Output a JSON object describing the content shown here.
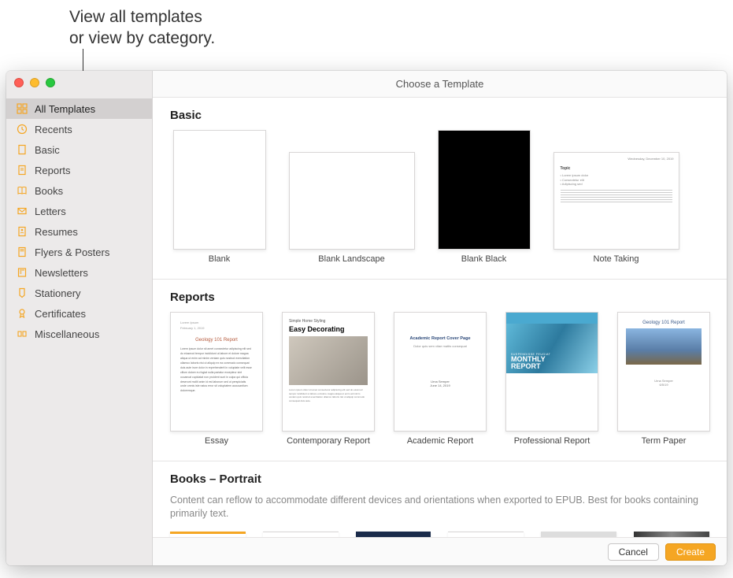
{
  "annotation": "View all templates\nor view by category.",
  "window_title": "Choose a Template",
  "sidebar": {
    "items": [
      {
        "label": "All Templates",
        "icon": "grid-icon",
        "selected": true
      },
      {
        "label": "Recents",
        "icon": "clock-icon"
      },
      {
        "label": "Basic",
        "icon": "page-icon"
      },
      {
        "label": "Reports",
        "icon": "report-icon"
      },
      {
        "label": "Books",
        "icon": "book-icon"
      },
      {
        "label": "Letters",
        "icon": "letter-icon"
      },
      {
        "label": "Resumes",
        "icon": "resume-icon"
      },
      {
        "label": "Flyers & Posters",
        "icon": "flyer-icon"
      },
      {
        "label": "Newsletters",
        "icon": "newsletter-icon"
      },
      {
        "label": "Stationery",
        "icon": "stationery-icon"
      },
      {
        "label": "Certificates",
        "icon": "certificate-icon"
      },
      {
        "label": "Miscellaneous",
        "icon": "misc-icon"
      }
    ]
  },
  "sections": {
    "basic": {
      "title": "Basic",
      "templates": [
        {
          "label": "Blank"
        },
        {
          "label": "Blank Landscape"
        },
        {
          "label": "Blank Black"
        },
        {
          "label": "Note Taking"
        }
      ]
    },
    "reports": {
      "title": "Reports",
      "templates": [
        {
          "label": "Essay"
        },
        {
          "label": "Contemporary Report"
        },
        {
          "label": "Academic Report"
        },
        {
          "label": "Professional Report"
        },
        {
          "label": "Term Paper"
        }
      ]
    },
    "books": {
      "title": "Books – Portrait",
      "description": "Content can reflow to accommodate different devices and orientations when exported to EPUB. Best for books containing primarily text."
    }
  },
  "thumb_text": {
    "essay_title": "Geology 101 Report",
    "contemp_sub": "Simple Home Styling",
    "contemp_title": "Easy Decorating",
    "acad_title": "Academic Report Cover Page",
    "prof_sub": "SUSPENDISSE FEUGIAT",
    "prof_title": "MONTHLY REPORT",
    "tp_title": "Geology 101 Report",
    "note_date": "Wednesday, December 10, 2019"
  },
  "footer": {
    "cancel": "Cancel",
    "create": "Create"
  }
}
